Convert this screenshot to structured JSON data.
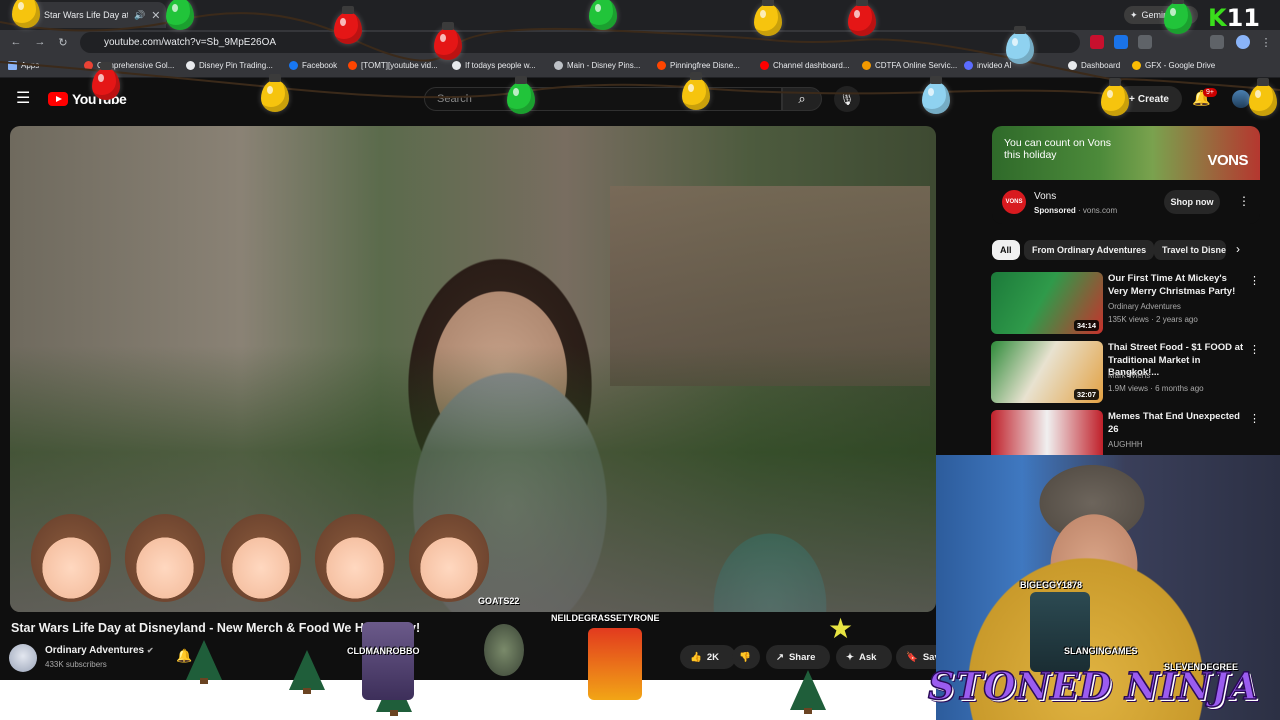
{
  "browser": {
    "tab_title": "Star Wars Life Day at D",
    "gemini_label": "Gemini",
    "url": "youtube.com/watch?v=Sb_9MpE26OA",
    "bookmarks": [
      {
        "label": "Apps",
        "color": "#8ab4f8"
      },
      {
        "label": "Comprehensive Gol...",
        "color": "#ea4335"
      },
      {
        "label": "Disney Pin Trading...",
        "color": "#e8eaed"
      },
      {
        "label": "Facebook",
        "color": "#1877f2"
      },
      {
        "label": "[TOMT][youtube vid...",
        "color": "#ff4500"
      },
      {
        "label": "If todays people w...",
        "color": "#e8eaed"
      },
      {
        "label": "Main - Disney Pins...",
        "color": "#bdc1c6"
      },
      {
        "label": "Pinningfree Disne...",
        "color": "#ff4500"
      },
      {
        "label": "Channel dashboard...",
        "color": "#ff0000"
      },
      {
        "label": "CDTFA Online Servic...",
        "color": "#f29900"
      },
      {
        "label": "invideo AI",
        "color": "#5b6cff"
      },
      {
        "label": "Dashboard",
        "color": "#e8eaed"
      },
      {
        "label": "GFX - Google Drive",
        "color": "#fbbc04"
      }
    ]
  },
  "youtube": {
    "logo_text": "YouTube",
    "search_placeholder": "Search",
    "create_label": "Create",
    "notif_badge": "9+"
  },
  "video": {
    "title": "Star Wars Life Day at Disneyland - New Merch & Food We Had to Try!",
    "watermark": "GOATS22",
    "channel_name": "Ordinary Adventures",
    "subscribers": "433K subscribers",
    "like_count": "2K",
    "share_label": "Share",
    "ask_label": "Ask",
    "save_label": "Save"
  },
  "ad": {
    "banner_line": "You can count on Vons this holiday",
    "banner_brand": "VONS",
    "logo_text": "VONS",
    "name": "Vons",
    "sponsored": "Sponsored",
    "domain": "vons.com",
    "cta": "Shop now"
  },
  "chips": [
    "All",
    "From Ordinary Adventures",
    "Travel to Disne"
  ],
  "recommendations": [
    {
      "title": "Our First Time At Mickey's Very Merry Christmas Party!",
      "channel": "Ordinary Adventures",
      "meta": "135K views · 2 years ago",
      "duration": "34:14",
      "colors": [
        "#1c7a3a",
        "#c8312c"
      ]
    },
    {
      "title": "Thai Street Food - $1 FOOD at Traditional Market in Bangkok!...",
      "channel": "Mark Wiens",
      "meta": "1.9M views · 6 months ago",
      "duration": "32:07",
      "colors": [
        "#2e8b3a",
        "#e3a142"
      ]
    },
    {
      "title": "Memes That End Unexpected 26",
      "channel": "AUGHHH",
      "meta": "",
      "duration": "",
      "colors": [
        "#c0202a",
        "#f0f0f0"
      ]
    }
  ],
  "stream": {
    "overlay_title": "STONED NINJA",
    "gamers": [
      "NEILDEGRASSETYRONE",
      "CLDMANROBBO",
      "BIGEGGY1878",
      "SLANGINGAMES",
      "SLEVENDEGREE"
    ],
    "corner_badge": "11"
  }
}
